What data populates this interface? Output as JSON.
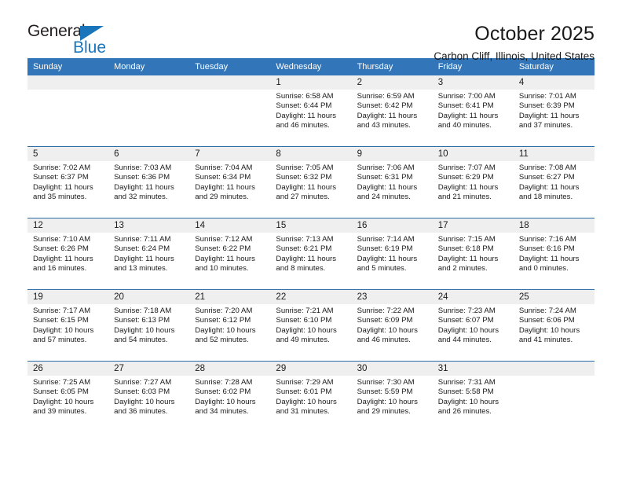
{
  "logo": {
    "word_top": "General",
    "word_bottom": "Blue",
    "triangle_icon": "triangle-icon",
    "brand_color": "#1b75bb"
  },
  "header": {
    "title": "October 2025",
    "subtitle": "Carbon Cliff, Illinois, United States"
  },
  "colors": {
    "header_blue": "#3275b8",
    "row_divider_blue": "#2a6ba8",
    "daynum_background": "#efefef",
    "text": "#1a1a1a"
  },
  "calendar": {
    "weekday_headers": [
      "Sunday",
      "Monday",
      "Tuesday",
      "Wednesday",
      "Thursday",
      "Friday",
      "Saturday"
    ],
    "weeks": [
      [
        {
          "empty": true,
          "day": "",
          "sunrise": "",
          "sunset": "",
          "daylight_line1": "",
          "daylight_line2": ""
        },
        {
          "empty": true,
          "day": "",
          "sunrise": "",
          "sunset": "",
          "daylight_line1": "",
          "daylight_line2": ""
        },
        {
          "empty": true,
          "day": "",
          "sunrise": "",
          "sunset": "",
          "daylight_line1": "",
          "daylight_line2": ""
        },
        {
          "empty": false,
          "day": "1",
          "sunrise": "Sunrise: 6:58 AM",
          "sunset": "Sunset: 6:44 PM",
          "daylight_line1": "Daylight: 11 hours",
          "daylight_line2": "and 46 minutes."
        },
        {
          "empty": false,
          "day": "2",
          "sunrise": "Sunrise: 6:59 AM",
          "sunset": "Sunset: 6:42 PM",
          "daylight_line1": "Daylight: 11 hours",
          "daylight_line2": "and 43 minutes."
        },
        {
          "empty": false,
          "day": "3",
          "sunrise": "Sunrise: 7:00 AM",
          "sunset": "Sunset: 6:41 PM",
          "daylight_line1": "Daylight: 11 hours",
          "daylight_line2": "and 40 minutes."
        },
        {
          "empty": false,
          "day": "4",
          "sunrise": "Sunrise: 7:01 AM",
          "sunset": "Sunset: 6:39 PM",
          "daylight_line1": "Daylight: 11 hours",
          "daylight_line2": "and 37 minutes."
        }
      ],
      [
        {
          "empty": false,
          "day": "5",
          "sunrise": "Sunrise: 7:02 AM",
          "sunset": "Sunset: 6:37 PM",
          "daylight_line1": "Daylight: 11 hours",
          "daylight_line2": "and 35 minutes."
        },
        {
          "empty": false,
          "day": "6",
          "sunrise": "Sunrise: 7:03 AM",
          "sunset": "Sunset: 6:36 PM",
          "daylight_line1": "Daylight: 11 hours",
          "daylight_line2": "and 32 minutes."
        },
        {
          "empty": false,
          "day": "7",
          "sunrise": "Sunrise: 7:04 AM",
          "sunset": "Sunset: 6:34 PM",
          "daylight_line1": "Daylight: 11 hours",
          "daylight_line2": "and 29 minutes."
        },
        {
          "empty": false,
          "day": "8",
          "sunrise": "Sunrise: 7:05 AM",
          "sunset": "Sunset: 6:32 PM",
          "daylight_line1": "Daylight: 11 hours",
          "daylight_line2": "and 27 minutes."
        },
        {
          "empty": false,
          "day": "9",
          "sunrise": "Sunrise: 7:06 AM",
          "sunset": "Sunset: 6:31 PM",
          "daylight_line1": "Daylight: 11 hours",
          "daylight_line2": "and 24 minutes."
        },
        {
          "empty": false,
          "day": "10",
          "sunrise": "Sunrise: 7:07 AM",
          "sunset": "Sunset: 6:29 PM",
          "daylight_line1": "Daylight: 11 hours",
          "daylight_line2": "and 21 minutes."
        },
        {
          "empty": false,
          "day": "11",
          "sunrise": "Sunrise: 7:08 AM",
          "sunset": "Sunset: 6:27 PM",
          "daylight_line1": "Daylight: 11 hours",
          "daylight_line2": "and 18 minutes."
        }
      ],
      [
        {
          "empty": false,
          "day": "12",
          "sunrise": "Sunrise: 7:10 AM",
          "sunset": "Sunset: 6:26 PM",
          "daylight_line1": "Daylight: 11 hours",
          "daylight_line2": "and 16 minutes."
        },
        {
          "empty": false,
          "day": "13",
          "sunrise": "Sunrise: 7:11 AM",
          "sunset": "Sunset: 6:24 PM",
          "daylight_line1": "Daylight: 11 hours",
          "daylight_line2": "and 13 minutes."
        },
        {
          "empty": false,
          "day": "14",
          "sunrise": "Sunrise: 7:12 AM",
          "sunset": "Sunset: 6:22 PM",
          "daylight_line1": "Daylight: 11 hours",
          "daylight_line2": "and 10 minutes."
        },
        {
          "empty": false,
          "day": "15",
          "sunrise": "Sunrise: 7:13 AM",
          "sunset": "Sunset: 6:21 PM",
          "daylight_line1": "Daylight: 11 hours",
          "daylight_line2": "and 8 minutes."
        },
        {
          "empty": false,
          "day": "16",
          "sunrise": "Sunrise: 7:14 AM",
          "sunset": "Sunset: 6:19 PM",
          "daylight_line1": "Daylight: 11 hours",
          "daylight_line2": "and 5 minutes."
        },
        {
          "empty": false,
          "day": "17",
          "sunrise": "Sunrise: 7:15 AM",
          "sunset": "Sunset: 6:18 PM",
          "daylight_line1": "Daylight: 11 hours",
          "daylight_line2": "and 2 minutes."
        },
        {
          "empty": false,
          "day": "18",
          "sunrise": "Sunrise: 7:16 AM",
          "sunset": "Sunset: 6:16 PM",
          "daylight_line1": "Daylight: 11 hours",
          "daylight_line2": "and 0 minutes."
        }
      ],
      [
        {
          "empty": false,
          "day": "19",
          "sunrise": "Sunrise: 7:17 AM",
          "sunset": "Sunset: 6:15 PM",
          "daylight_line1": "Daylight: 10 hours",
          "daylight_line2": "and 57 minutes."
        },
        {
          "empty": false,
          "day": "20",
          "sunrise": "Sunrise: 7:18 AM",
          "sunset": "Sunset: 6:13 PM",
          "daylight_line1": "Daylight: 10 hours",
          "daylight_line2": "and 54 minutes."
        },
        {
          "empty": false,
          "day": "21",
          "sunrise": "Sunrise: 7:20 AM",
          "sunset": "Sunset: 6:12 PM",
          "daylight_line1": "Daylight: 10 hours",
          "daylight_line2": "and 52 minutes."
        },
        {
          "empty": false,
          "day": "22",
          "sunrise": "Sunrise: 7:21 AM",
          "sunset": "Sunset: 6:10 PM",
          "daylight_line1": "Daylight: 10 hours",
          "daylight_line2": "and 49 minutes."
        },
        {
          "empty": false,
          "day": "23",
          "sunrise": "Sunrise: 7:22 AM",
          "sunset": "Sunset: 6:09 PM",
          "daylight_line1": "Daylight: 10 hours",
          "daylight_line2": "and 46 minutes."
        },
        {
          "empty": false,
          "day": "24",
          "sunrise": "Sunrise: 7:23 AM",
          "sunset": "Sunset: 6:07 PM",
          "daylight_line1": "Daylight: 10 hours",
          "daylight_line2": "and 44 minutes."
        },
        {
          "empty": false,
          "day": "25",
          "sunrise": "Sunrise: 7:24 AM",
          "sunset": "Sunset: 6:06 PM",
          "daylight_line1": "Daylight: 10 hours",
          "daylight_line2": "and 41 minutes."
        }
      ],
      [
        {
          "empty": false,
          "day": "26",
          "sunrise": "Sunrise: 7:25 AM",
          "sunset": "Sunset: 6:05 PM",
          "daylight_line1": "Daylight: 10 hours",
          "daylight_line2": "and 39 minutes."
        },
        {
          "empty": false,
          "day": "27",
          "sunrise": "Sunrise: 7:27 AM",
          "sunset": "Sunset: 6:03 PM",
          "daylight_line1": "Daylight: 10 hours",
          "daylight_line2": "and 36 minutes."
        },
        {
          "empty": false,
          "day": "28",
          "sunrise": "Sunrise: 7:28 AM",
          "sunset": "Sunset: 6:02 PM",
          "daylight_line1": "Daylight: 10 hours",
          "daylight_line2": "and 34 minutes."
        },
        {
          "empty": false,
          "day": "29",
          "sunrise": "Sunrise: 7:29 AM",
          "sunset": "Sunset: 6:01 PM",
          "daylight_line1": "Daylight: 10 hours",
          "daylight_line2": "and 31 minutes."
        },
        {
          "empty": false,
          "day": "30",
          "sunrise": "Sunrise: 7:30 AM",
          "sunset": "Sunset: 5:59 PM",
          "daylight_line1": "Daylight: 10 hours",
          "daylight_line2": "and 29 minutes."
        },
        {
          "empty": false,
          "day": "31",
          "sunrise": "Sunrise: 7:31 AM",
          "sunset": "Sunset: 5:58 PM",
          "daylight_line1": "Daylight: 10 hours",
          "daylight_line2": "and 26 minutes."
        },
        {
          "empty": true,
          "day": "",
          "sunrise": "",
          "sunset": "",
          "daylight_line1": "",
          "daylight_line2": ""
        }
      ]
    ]
  }
}
